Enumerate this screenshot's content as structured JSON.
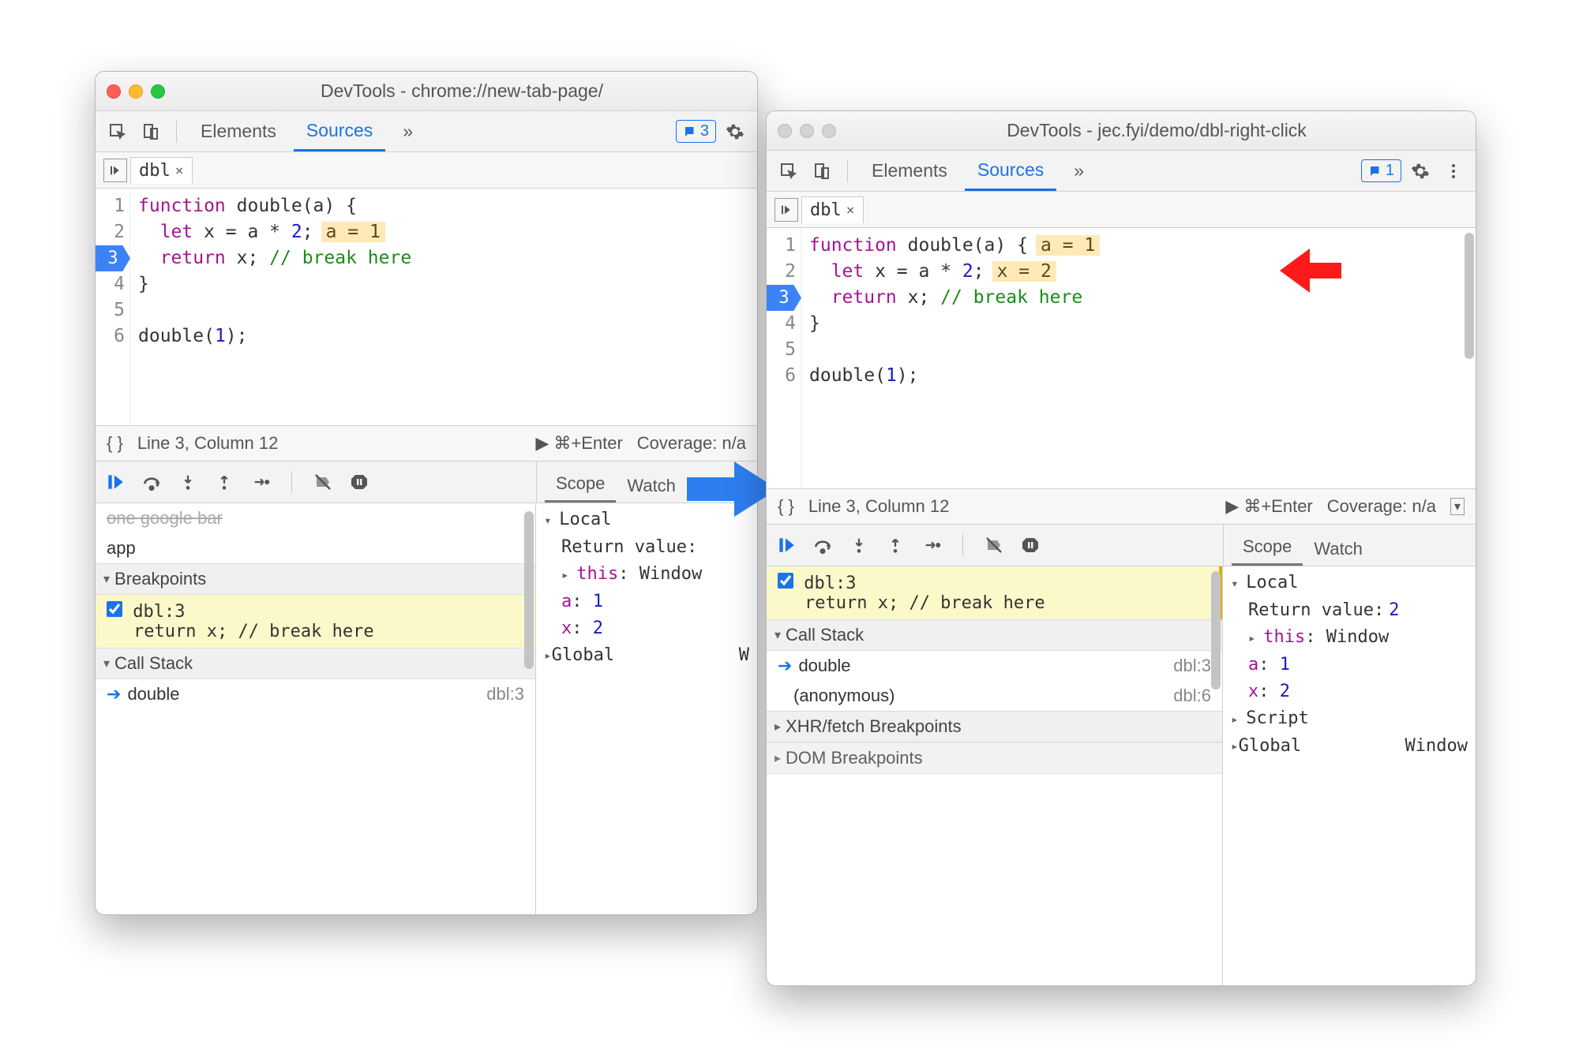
{
  "windowA": {
    "title": "DevTools - chrome://new-tab-page/",
    "tabs": {
      "elements": "Elements",
      "sources": "Sources"
    },
    "badge_count": "3",
    "file_tab": "dbl",
    "code": {
      "l1a": "function",
      "l1b": " double(a) {",
      "l2a": "  let",
      "l2b": " x = a * ",
      "l2c": "2",
      "l2d": ";",
      "l2_inline": "a = 1",
      "l3a": "  return",
      "l3b": " x; ",
      "l3c": "// break here",
      "l4": "}",
      "l5": "",
      "l6a": "double(",
      "l6b": "1",
      "l6c": ");"
    },
    "line_nums": [
      "1",
      "2",
      "3",
      "4",
      "5",
      "6"
    ],
    "status": {
      "linecol": "Line 3, Column 12",
      "run": "▶ ⌘+Enter",
      "coverage": "Coverage: n/a"
    },
    "left_rows": {
      "app": "app",
      "breakpoints": "Breakpoints",
      "callstack": "Call Stack"
    },
    "bp": {
      "label": "dbl:3",
      "code": "return x; // break here"
    },
    "cs": {
      "fn": "double",
      "loc": "dbl:3"
    },
    "scope": {
      "tab_scope": "Scope",
      "tab_watch": "Watch",
      "local": "Local",
      "retval": "Return value:",
      "this_k": "this",
      "this_v": "Window",
      "a_k": "a",
      "a_v": "1",
      "x_k": "x",
      "x_v": "2",
      "global": "Global",
      "global_v": "W"
    }
  },
  "windowB": {
    "title": "DevTools - jec.fyi/demo/dbl-right-click",
    "tabs": {
      "elements": "Elements",
      "sources": "Sources"
    },
    "badge_count": "1",
    "file_tab": "dbl",
    "code": {
      "l1a": "function",
      "l1b": " double(a) {",
      "l1_inline": "a = 1",
      "l2a": "  let",
      "l2b": " x = a * ",
      "l2c": "2",
      "l2d": ";",
      "l2_inline": "x = 2",
      "l3a": "  return",
      "l3b": " x; ",
      "l3c": "// break here",
      "l4": "}",
      "l5": "",
      "l6a": "double(",
      "l6b": "1",
      "l6c": ");"
    },
    "line_nums": [
      "1",
      "2",
      "3",
      "4",
      "5",
      "6"
    ],
    "status": {
      "linecol": "Line 3, Column 12",
      "run": "▶ ⌘+Enter",
      "coverage": "Coverage: n/a"
    },
    "bp": {
      "label": "dbl:3",
      "code": "return x; // break here"
    },
    "callstack_hd": "Call Stack",
    "cs": [
      {
        "fn": "double",
        "loc": "dbl:3"
      },
      {
        "fn": "(anonymous)",
        "loc": "dbl:6"
      }
    ],
    "xhr": "XHR/fetch Breakpoints",
    "dom": "DOM Breakpoints",
    "scope": {
      "tab_scope": "Scope",
      "tab_watch": "Watch",
      "local": "Local",
      "retval_k": "Return value",
      "retval_v": "2",
      "this_k": "this",
      "this_v": "Window",
      "a_k": "a",
      "a_v": "1",
      "x_k": "x",
      "x_v": "2",
      "script": "Script",
      "global": "Global",
      "global_v": "Window"
    }
  }
}
